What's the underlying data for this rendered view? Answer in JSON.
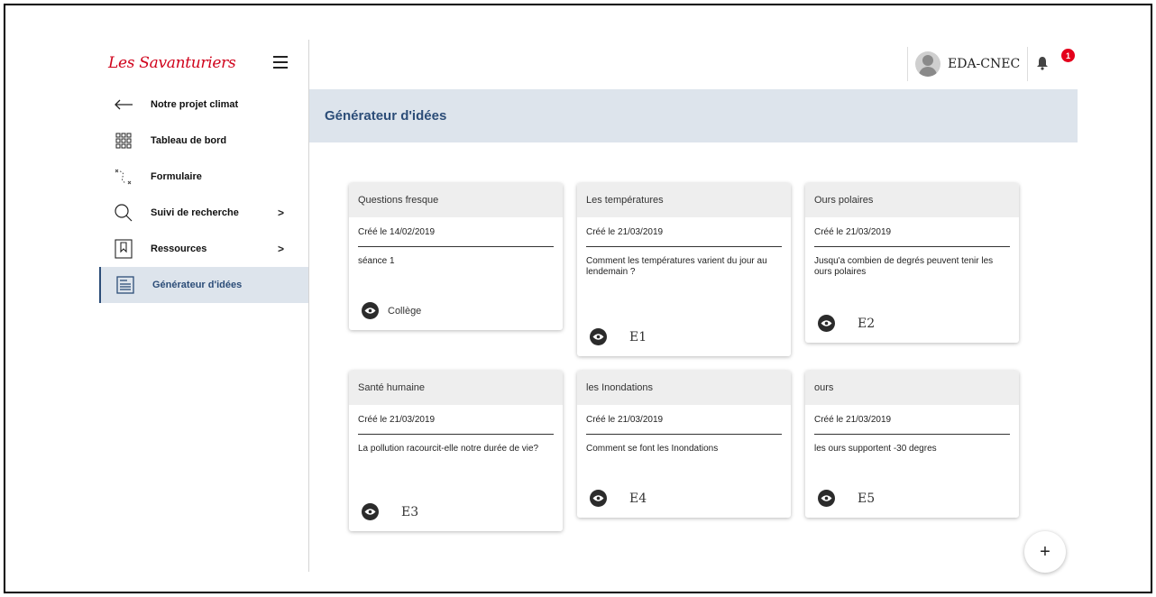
{
  "app": {
    "logo_text": "Les Savanturiers",
    "brand_color": "#d0021b",
    "accent_color": "#2c4d78"
  },
  "topbar": {
    "user_name": "EDA-CNEC",
    "notification_count": "1",
    "bell_icon": "bell-icon"
  },
  "sidebar": {
    "items": [
      {
        "label": "Notre projet climat",
        "icon": "arrow-left-icon"
      },
      {
        "label": "Tableau de bord",
        "icon": "grid-icon"
      },
      {
        "label": "Formulaire",
        "icon": "path-icon"
      },
      {
        "label": "Suivi de recherche",
        "icon": "search-icon",
        "chevron": ">"
      },
      {
        "label": "Ressources",
        "icon": "bookmark-icon",
        "chevron": ">"
      },
      {
        "label": "Générateur d'idées",
        "icon": "document-icon",
        "active": true
      }
    ]
  },
  "page": {
    "title": "Générateur d'idées"
  },
  "cards": [
    {
      "title": "Questions fresque",
      "date": "Créé le 14/02/2019",
      "description": "séance 1",
      "tag": "Collège"
    },
    {
      "title": "Les températures",
      "date": "Créé le 21/03/2019",
      "description": "Comment les températures varient du jour au lendemain ?",
      "tag": "E1"
    },
    {
      "title": "Ours polaires",
      "date": "Créé le 21/03/2019",
      "description": "Jusqu'a combien de degrés peuvent tenir les ours polaires",
      "tag": "E2"
    },
    {
      "title": "Santé humaine",
      "date": "Créé le 21/03/2019",
      "description": "La pollution racourcit-elle notre durée de vie?",
      "tag": "E3"
    },
    {
      "title": "les Inondations",
      "date": "Créé le 21/03/2019",
      "description": "Comment se font les Inondations",
      "tag": "E4"
    },
    {
      "title": "ours",
      "date": "Créé le 21/03/2019",
      "description": "les ours supportent -30 degres",
      "tag": "E5"
    }
  ],
  "fab": {
    "label": "+"
  }
}
